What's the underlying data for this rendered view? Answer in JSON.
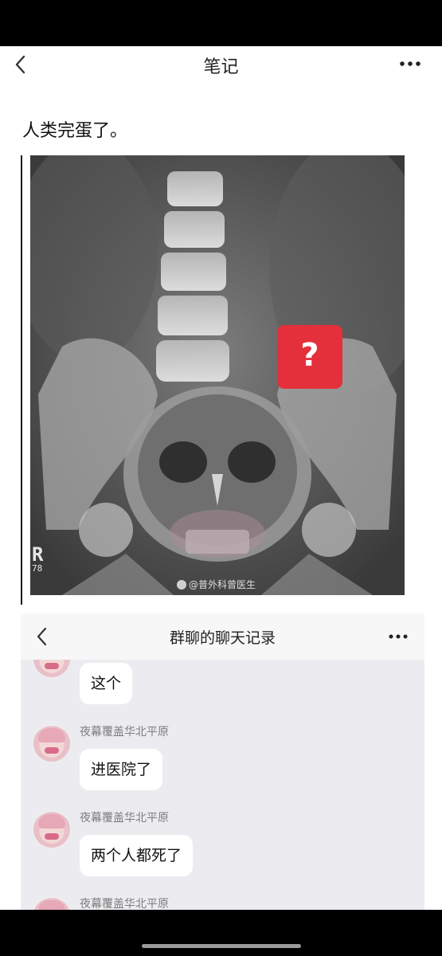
{
  "nav": {
    "title": "笔记",
    "back_icon": "chevron-left-icon",
    "more_icon": "more-dots-icon"
  },
  "post": {
    "text": "人类完蛋了。"
  },
  "image": {
    "badge": "?",
    "watermark": "@普外科曾医生",
    "corner_letter": "R",
    "corner_number": "78"
  },
  "chat": {
    "title": "群聊的聊天记录",
    "messages": [
      {
        "sender": "",
        "text": "这个"
      },
      {
        "sender": "夜幕覆盖华北平原",
        "text": "进医院了"
      },
      {
        "sender": "夜幕覆盖华北平原",
        "text": "两个人都死了"
      },
      {
        "sender": "夜幕覆盖华北平原",
        "text": ""
      }
    ]
  },
  "colors": {
    "badge": "#e4303b",
    "chat_bg": "#ececf0",
    "bubble": "#ffffff"
  }
}
